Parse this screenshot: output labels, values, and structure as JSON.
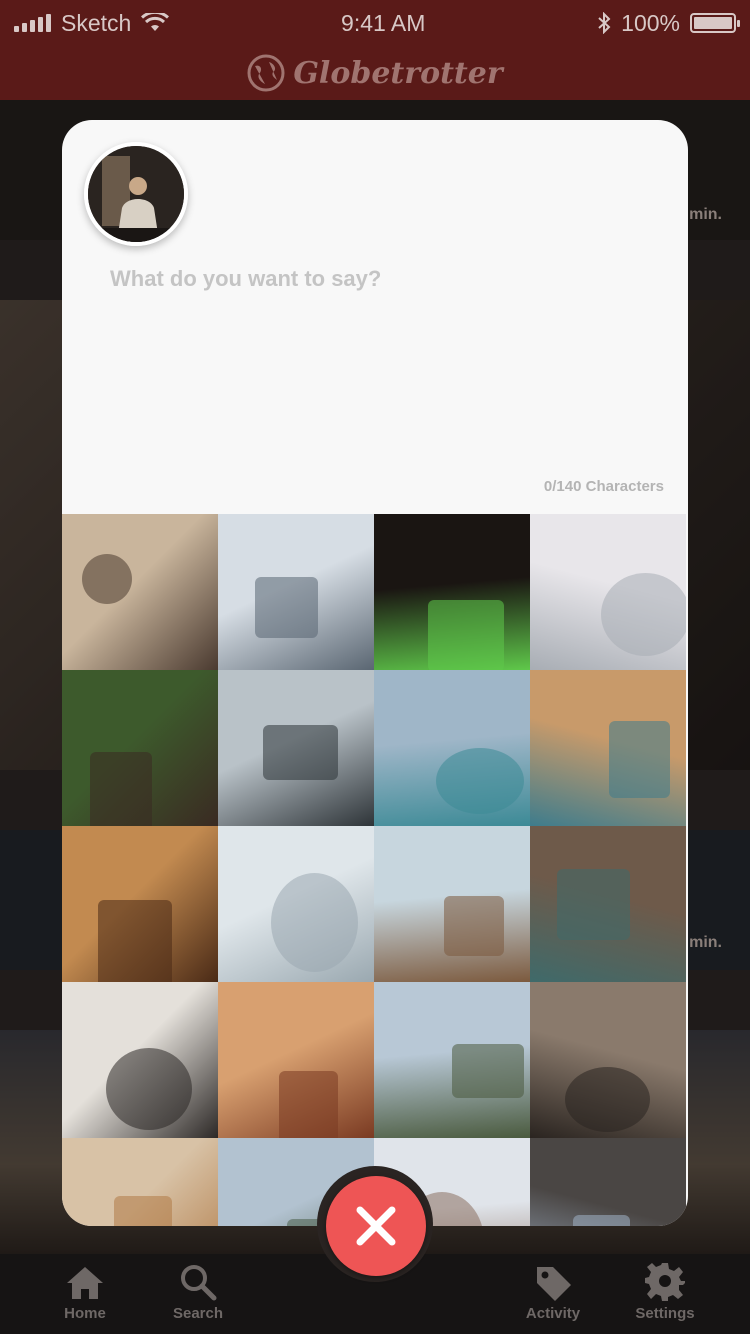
{
  "status_bar": {
    "carrier": "Sketch",
    "time": "9:41 AM",
    "battery": "100%"
  },
  "app": {
    "brand": "Globetrotter"
  },
  "background": {
    "meta_1": "min.",
    "meta_2": "min."
  },
  "composer": {
    "placeholder": "What do you want to say?",
    "value": "",
    "char_count": "0/140 Characters"
  },
  "photos": [
    {
      "name": "photo-desert-camera",
      "c1": "#c9b59c",
      "c2": "#4a3a30"
    },
    {
      "name": "photo-airport-walkway",
      "c1": "#d6dde4",
      "c2": "#5a6672"
    },
    {
      "name": "photo-night-tent",
      "c1": "#1a1512",
      "c2": "#5fc84a"
    },
    {
      "name": "photo-airplane-wing",
      "c1": "#e8e6ea",
      "c2": "#a8adb4"
    },
    {
      "name": "photo-horse-rider",
      "c1": "#3d5a2c",
      "c2": "#3a2a22"
    },
    {
      "name": "photo-ferry-window",
      "c1": "#b9c2c8",
      "c2": "#2e3438"
    },
    {
      "name": "photo-mountain-lake",
      "c1": "#9fb6c8",
      "c2": "#3c8a96"
    },
    {
      "name": "photo-coastal-village",
      "c1": "#c89a6a",
      "c2": "#3e7c8c"
    },
    {
      "name": "photo-wood-world-map",
      "c1": "#c28a50",
      "c2": "#4a2a16"
    },
    {
      "name": "photo-buddha-statue",
      "c1": "#dfe6ea",
      "c2": "#9aa8b0"
    },
    {
      "name": "photo-pier-surfer",
      "c1": "#c7d6de",
      "c2": "#7c5a3e"
    },
    {
      "name": "photo-cave-waterfall",
      "c1": "#6e5a4a",
      "c2": "#3f6a6a"
    },
    {
      "name": "photo-airport-seats",
      "c1": "#e4e0da",
      "c2": "#2c2826"
    },
    {
      "name": "photo-sunset-deck",
      "c1": "#d8a070",
      "c2": "#7a3a22"
    },
    {
      "name": "photo-aerial-city",
      "c1": "#b8c8d6",
      "c2": "#4a5a3e"
    },
    {
      "name": "photo-woman-ruins",
      "c1": "#8a7a6c",
      "c2": "#2a2420"
    },
    {
      "name": "photo-globe-map",
      "c1": "#d8c2a6",
      "c2": "#b07a46"
    },
    {
      "name": "photo-mountain-range",
      "c1": "#b2c2d0",
      "c2": "#4a5e4a"
    },
    {
      "name": "photo-city-skyline",
      "c1": "#e0e4ea",
      "c2": "#8a7060"
    },
    {
      "name": "photo-building-facade",
      "c1": "#4a4644",
      "c2": "#9fb0c4"
    }
  ],
  "tabs": [
    {
      "label": "Home"
    },
    {
      "label": "Search"
    },
    {
      "label": "Activity"
    },
    {
      "label": "Settings"
    }
  ],
  "colors": {
    "accent_close": "#ee5555",
    "nav_bg": "#5a1a18",
    "modal_bg": "#f8f8f8"
  }
}
